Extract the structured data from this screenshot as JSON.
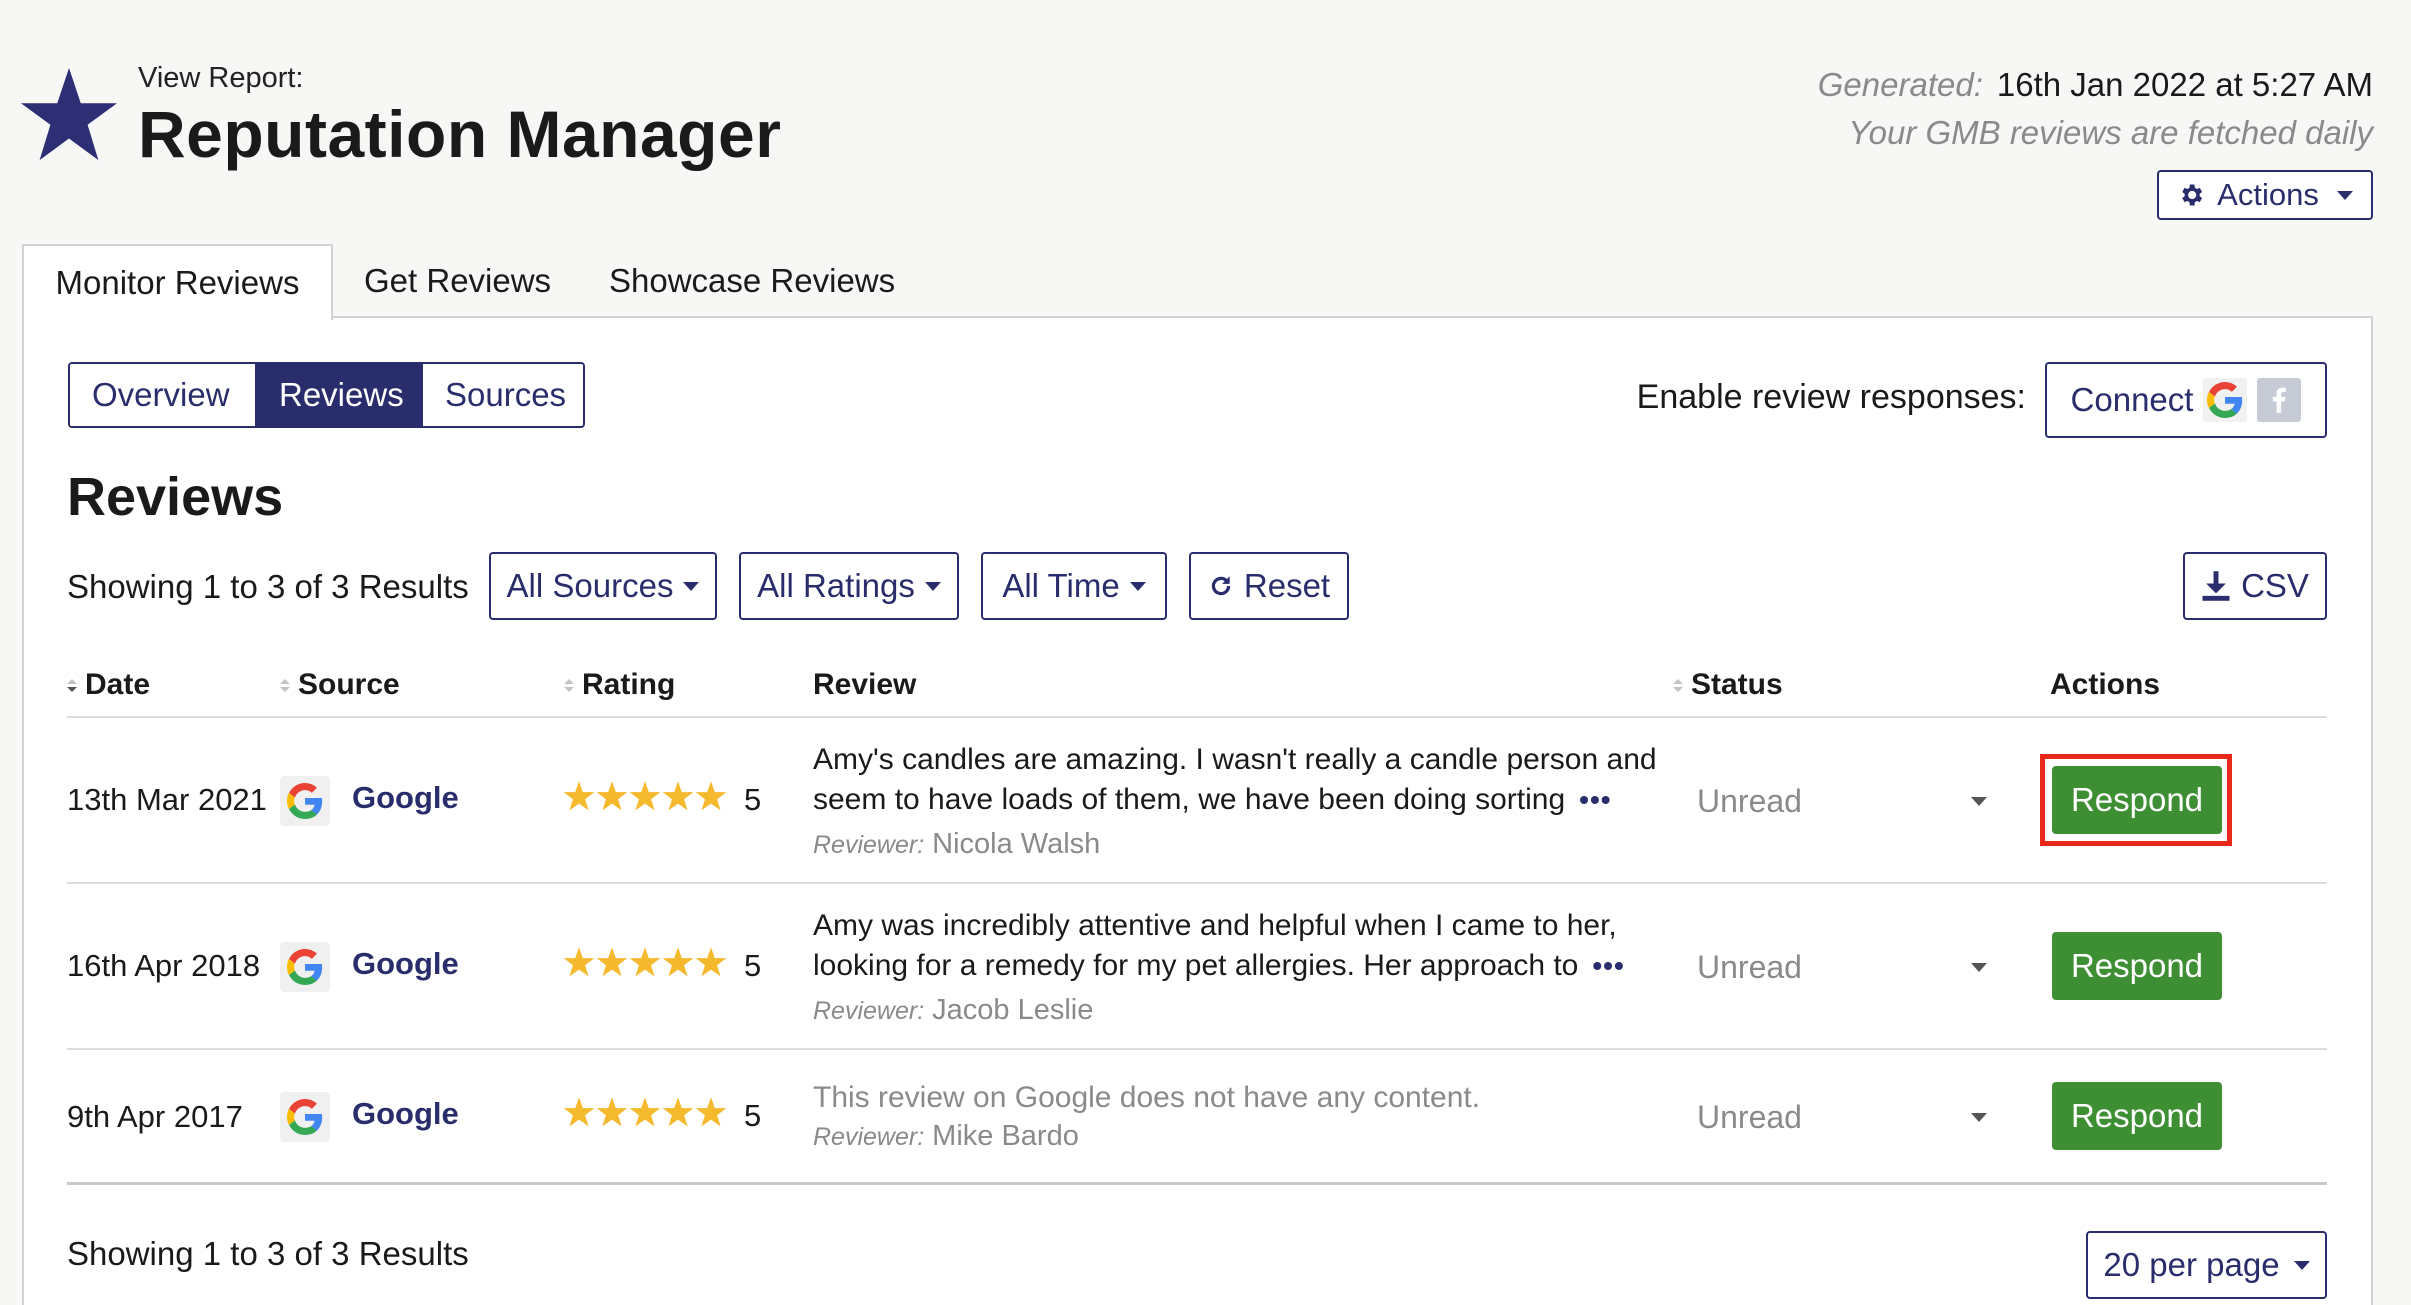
{
  "header": {
    "view_label": "View Report:",
    "title": "Reputation Manager",
    "generated_label": "Generated:",
    "generated_value": "16th Jan 2022 at 5:27 AM",
    "fetch_note": "Your GMB reviews are fetched daily",
    "actions_label": "Actions"
  },
  "tabs": [
    {
      "label": "Monitor Reviews",
      "active": true
    },
    {
      "label": "Get Reviews",
      "active": false
    },
    {
      "label": "Showcase Reviews",
      "active": false
    }
  ],
  "subnav": [
    {
      "label": "Overview",
      "active": false
    },
    {
      "label": "Reviews",
      "active": true
    },
    {
      "label": "Sources",
      "active": false
    }
  ],
  "connect": {
    "label": "Enable review responses:",
    "button_label": "Connect",
    "icons": [
      "google-icon",
      "facebook-icon"
    ]
  },
  "reviews_heading": "Reviews",
  "filters": {
    "showing_text": "Showing 1 to 3 of 3 Results",
    "sources": "All Sources",
    "ratings": "All Ratings",
    "time": "All Time",
    "reset": "Reset",
    "csv": "CSV"
  },
  "table": {
    "headers": [
      "Date",
      "Source",
      "Rating",
      "Review",
      "Status",
      "Actions"
    ],
    "reviewer_label": "Reviewer:",
    "rows": [
      {
        "date": "13th Mar 2021",
        "source": "Google",
        "rating": "5",
        "review_line1": "Amy's candles are amazing. I wasn't really a candle person and",
        "review_line2": "seem to have loads of them, we have been doing sorting",
        "reviewer": "Nicola Walsh",
        "status": "Unread",
        "action": "Respond"
      },
      {
        "date": "16th Apr 2018",
        "source": "Google",
        "rating": "5",
        "review_line1": "Amy was incredibly attentive and helpful when I came to her,",
        "review_line2": "looking for a remedy for my pet allergies. Her approach to",
        "reviewer": "Jacob Leslie",
        "status": "Unread",
        "action": "Respond"
      },
      {
        "date": "9th Apr 2017",
        "source": "Google",
        "rating": "5",
        "review_empty": "This review on Google does not have any content.",
        "reviewer": "Mike Bardo",
        "status": "Unread",
        "action": "Respond"
      }
    ]
  },
  "footer": {
    "showing_text": "Showing 1 to 3 of 3 Results",
    "per_page": "20 per page"
  },
  "colors": {
    "accent": "#2a2d6c",
    "respond_green": "#3e8e34",
    "star_gold": "#f5b92e",
    "highlight_red": "#e8281b"
  }
}
